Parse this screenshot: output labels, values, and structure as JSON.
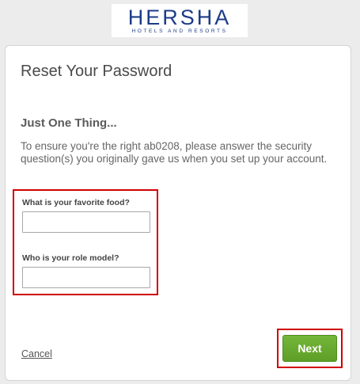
{
  "brand": {
    "logo_main": "HERSHA",
    "logo_sub": "HOTELS AND RESORTS",
    "color": "#1d3c87"
  },
  "card": {
    "title": "Reset Your Password",
    "subtitle": "Just One Thing...",
    "instructions": "To ensure you're the right ab0208, please answer the security question(s) you originally gave us when you set up your account."
  },
  "questions": [
    {
      "label": "What is your favorite food?",
      "value": "",
      "placeholder": ""
    },
    {
      "label": "Who is your role model?",
      "value": "",
      "placeholder": ""
    }
  ],
  "actions": {
    "cancel_label": "Cancel",
    "next_label": "Next"
  },
  "colors": {
    "accent_green": "#6aaa2f",
    "highlight_red": "#d00000",
    "background": "#ececec"
  }
}
